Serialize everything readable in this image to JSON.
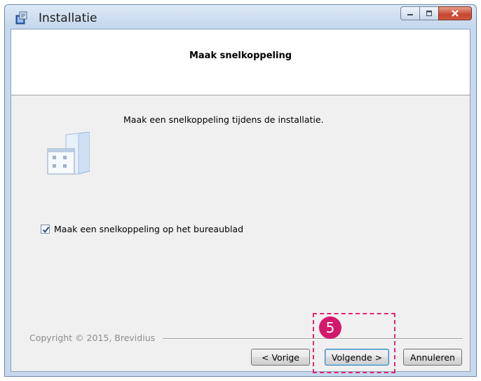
{
  "window": {
    "title": "Installatie",
    "icon": "installer-icon",
    "caption_buttons": [
      "minimize-icon",
      "maximize-icon",
      "close-icon"
    ]
  },
  "header": {
    "title": "Maak snelkoppeling"
  },
  "main": {
    "description": "Maak een snelkoppeling tijdens de installatie.",
    "icon": "shortcut-window-icon",
    "checkbox": {
      "label": "Maak een snelkoppeling op het bureaublad",
      "checked": true
    }
  },
  "footer": {
    "copyright": "Copyright © 2015, Brevidius",
    "buttons": {
      "prev": "< Vorige",
      "next": "Volgende >",
      "cancel": "Annuleren"
    }
  },
  "annotation": {
    "step": "5",
    "color": "#d2196c"
  }
}
